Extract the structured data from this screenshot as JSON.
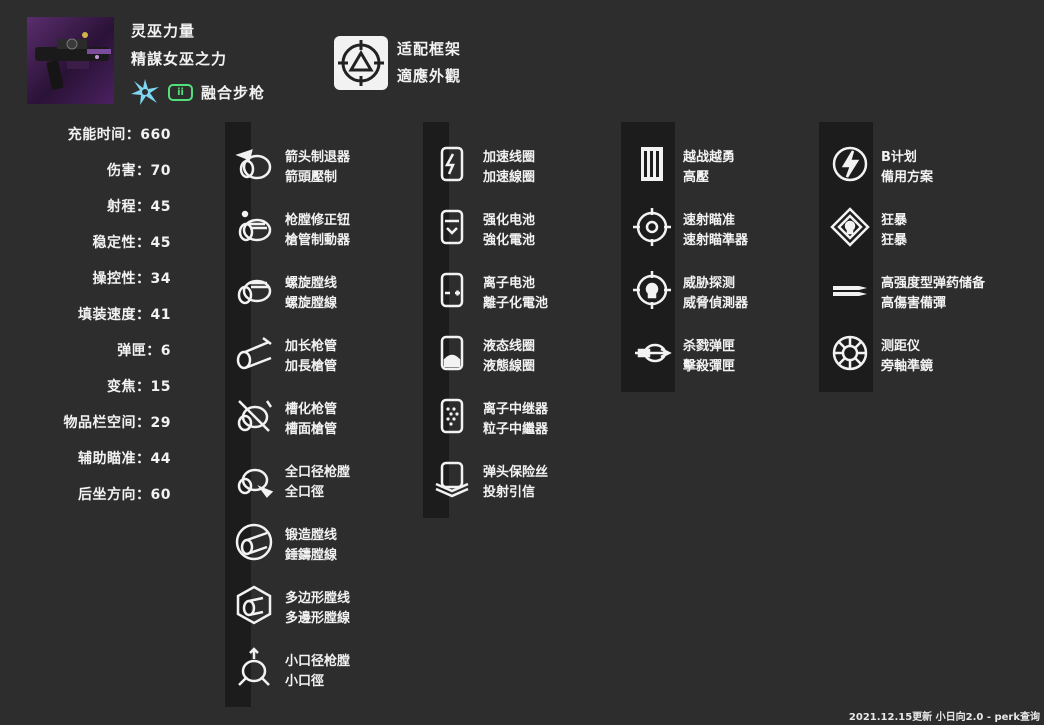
{
  "weapon": {
    "name": "灵巫力量",
    "name_alt": "精謀女巫之力",
    "type": "融合步枪",
    "ammo_icon": "primary-ammo-icon",
    "element_icon": "arc-damage-icon",
    "ammo_color": "#53e07c",
    "element_color": "#7fd6f2"
  },
  "frame": {
    "icon": "adaptive-frame-icon",
    "name": "适配框架",
    "name_alt": "適應外觀"
  },
  "stats": [
    "充能时间：660",
    "伤害：70",
    "射程：45",
    "稳定性：45",
    "操控性：34",
    "填装速度：41",
    "弹匣：6",
    "变焦：15",
    "物品栏空间：29",
    "辅助瞄准：44",
    "后坐方向：60"
  ],
  "columns": [
    {
      "perks": [
        {
          "name": "箭头制退器",
          "name_alt": "箭頭壓制",
          "icon": "arrowhead-brake-icon"
        },
        {
          "name": "枪膛修正钮",
          "name_alt": "槍管制動器",
          "icon": "corkscrew-rifling-icon"
        },
        {
          "name": "螺旋膛线",
          "name_alt": "螺旋膛線",
          "icon": "fluted-barrel-icon"
        },
        {
          "name": "加长枪管",
          "name_alt": "加長槍管",
          "icon": "extended-barrel-icon"
        },
        {
          "name": "槽化枪管",
          "name_alt": "槽面槍管",
          "icon": "chambered-compensator-icon"
        },
        {
          "name": "全口径枪膛",
          "name_alt": "全口徑",
          "icon": "full-bore-icon"
        },
        {
          "name": "锻造膛线",
          "name_alt": "錘鑄膛線",
          "icon": "hammer-forged-icon"
        },
        {
          "name": "多边形膛线",
          "name_alt": "多邊形膛線",
          "icon": "polygonal-rifling-icon"
        },
        {
          "name": "小口径枪膛",
          "name_alt": "小口徑",
          "icon": "smallbore-icon"
        }
      ]
    },
    {
      "perks": [
        {
          "name": "加速线圈",
          "name_alt": "加速線圈",
          "icon": "accelerated-coils-icon"
        },
        {
          "name": "强化电池",
          "name_alt": "強化電池",
          "icon": "enhanced-battery-icon"
        },
        {
          "name": "离子电池",
          "name_alt": "離子化電池",
          "icon": "ionized-battery-icon"
        },
        {
          "name": "液态线圈",
          "name_alt": "液態線圈",
          "icon": "liquid-coils-icon"
        },
        {
          "name": "离子中继器",
          "name_alt": "粒子中繼器",
          "icon": "particle-repeater-icon"
        },
        {
          "name": "弹头保险丝",
          "name_alt": "投射引信",
          "icon": "projection-fuse-icon"
        }
      ]
    },
    {
      "perks": [
        {
          "name": "越战越勇",
          "name_alt": "高壓",
          "icon": "high-pressure-icon"
        },
        {
          "name": "速射瞄准",
          "name_alt": "速射瞄準器",
          "icon": "rapid-fire-sights-icon"
        },
        {
          "name": "威胁探测",
          "name_alt": "威脅偵測器",
          "icon": "threat-detector-icon"
        },
        {
          "name": "杀戮弹匣",
          "name_alt": "擊殺彈匣",
          "icon": "killing-wind-mag-icon"
        }
      ]
    },
    {
      "perks": [
        {
          "name": "B计划",
          "name_alt": "備用方案",
          "icon": "plan-c-icon"
        },
        {
          "name": "狂暴",
          "name_alt": "狂暴",
          "icon": "rampage-icon"
        },
        {
          "name": "高强度型弹药储备",
          "name_alt": "高傷害備彈",
          "icon": "ammo-reserve-icon"
        },
        {
          "name": "测距仪",
          "name_alt": "旁軸準鏡",
          "icon": "rangefinder-icon"
        }
      ]
    }
  ],
  "footer": "2021.12.15更新 小日向2.0 - perk查询"
}
